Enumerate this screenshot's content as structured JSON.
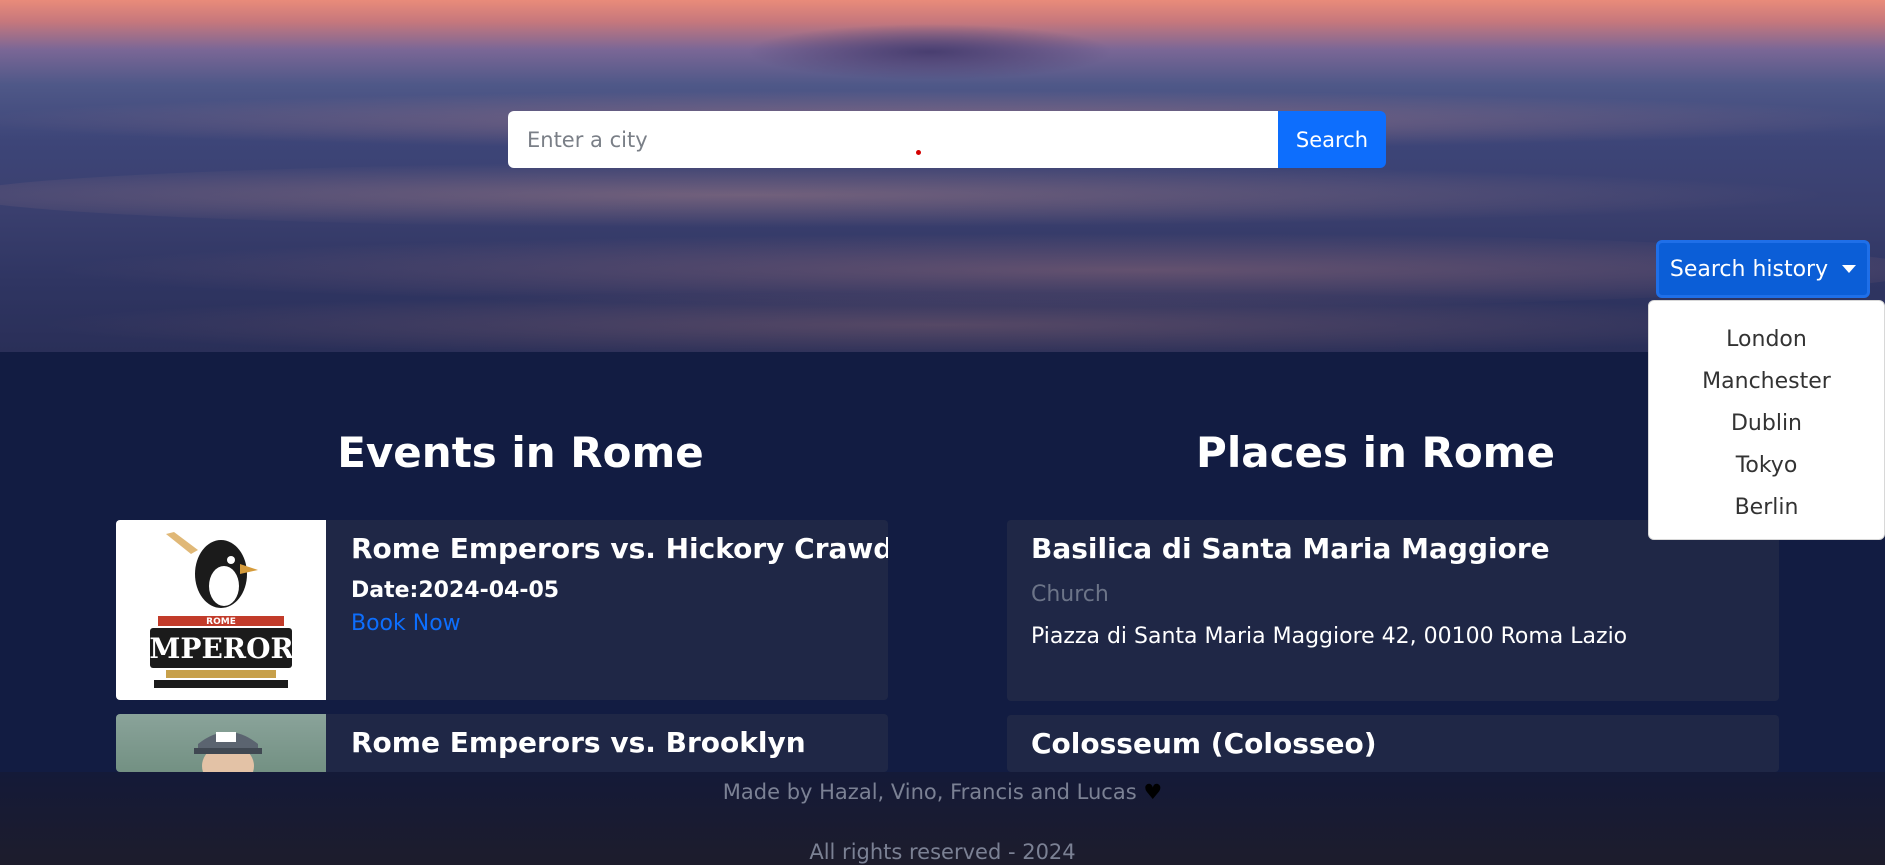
{
  "hero": {
    "search_placeholder": "Enter a city",
    "search_value": "",
    "search_button": "Search"
  },
  "history": {
    "button_label": "Search history",
    "items": [
      "London",
      "Manchester",
      "Dublin",
      "Tokyo",
      "Berlin"
    ]
  },
  "events": {
    "title": "Events in Rome",
    "cards": [
      {
        "title": "Rome Emperors vs. Hickory Crawdads",
        "date_label": "Date:",
        "date": "2024-04-05",
        "link": "Book Now",
        "logo_top": "ROME",
        "logo_main": "EMPERORS"
      },
      {
        "title": "Rome Emperors vs. Brooklyn"
      }
    ]
  },
  "places": {
    "title": "Places in Rome",
    "cards": [
      {
        "title": "Basilica di Santa Maria Maggiore",
        "type": "Church",
        "address": "Piazza di Santa Maria Maggiore 42, 00100 Roma Lazio"
      },
      {
        "title": "Colosseum (Colosseo)"
      }
    ]
  },
  "footer": {
    "credit": "Made by Hazal, Vino, Francis and Lucas",
    "rights": "All rights reserved - 2024"
  }
}
